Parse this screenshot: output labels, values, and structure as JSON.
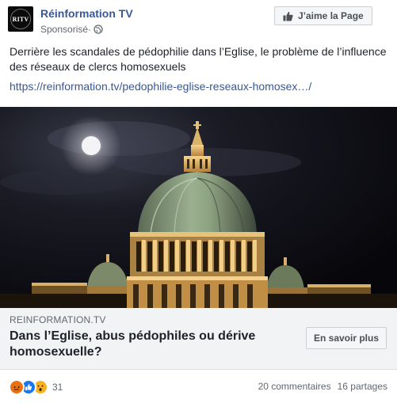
{
  "header": {
    "avatar_text": "RITV",
    "page_name": "Réinformation TV",
    "sponsored": "Sponsorisé",
    "separator": " · ",
    "like_page_label": "J’aime la Page"
  },
  "post": {
    "text": "Derrière les scandales de pédophilie dans l’Eglise, le problème de l’influence des réseaux de clercs homosexuels",
    "link_text": "https://reinformation.tv/pedophilie-eglise-reseaux-homosex…/"
  },
  "link_preview": {
    "domain": "REINFORMATION.TV",
    "title": "Dans l’Eglise, abus pédophiles ou dérive homosexuelle?",
    "cta_label": "En savoir plus"
  },
  "footer": {
    "reaction_icons": [
      "angry-reaction",
      "like-reaction",
      "wow-reaction"
    ],
    "reaction_count": "31",
    "comments": "20 commentaires",
    "shares": "16 partages"
  },
  "colors": {
    "link_blue": "#365899",
    "like_blue": "#1877f2",
    "angry_orange": "#e9710f",
    "wow_yellow": "#f7b125",
    "preview_background": "#f2f3f5"
  }
}
